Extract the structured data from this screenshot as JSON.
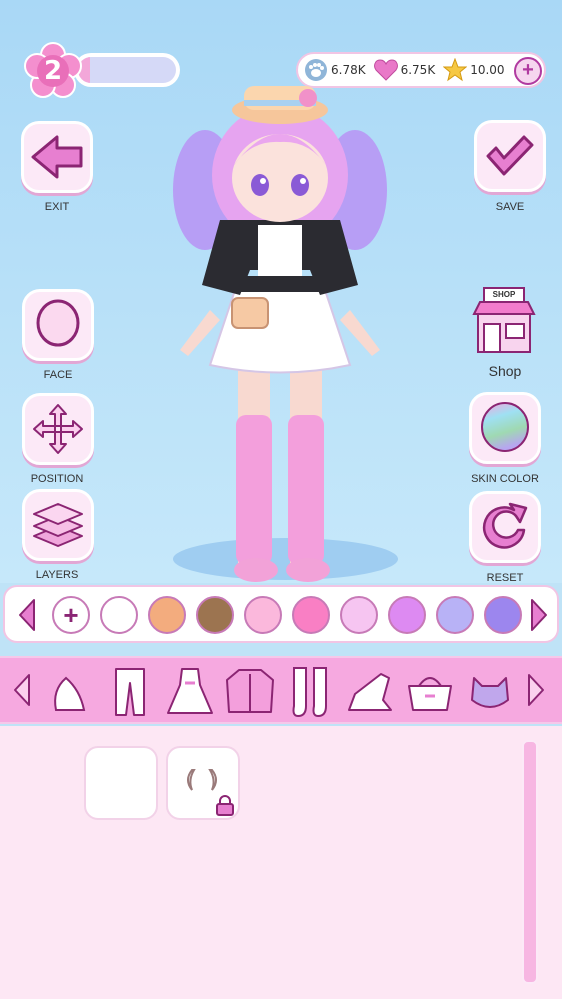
{
  "level": {
    "value": "2",
    "progress": 0.12
  },
  "currency": {
    "paw": {
      "icon": "paw-icon",
      "value": "6.78K"
    },
    "heart": {
      "icon": "heart-icon",
      "value": "6.75K"
    },
    "star": {
      "icon": "star-icon",
      "value": "10.00"
    },
    "add_label": "+"
  },
  "left_buttons": [
    {
      "label": "EXIT",
      "icon": "back-arrow-icon"
    },
    {
      "label": "FACE",
      "icon": "face-icon"
    },
    {
      "label": "POSITION",
      "icon": "move-icon"
    },
    {
      "label": "LAYERS",
      "icon": "layers-icon"
    }
  ],
  "right_buttons": [
    {
      "label": "SAVE",
      "icon": "checkmark-icon"
    },
    {
      "label": "Shop",
      "icon": "shop-icon",
      "sign": "SHOP"
    },
    {
      "label": "SKIN COLOR",
      "icon": "skin-color-icon"
    },
    {
      "label": "RESET",
      "icon": "reset-icon"
    }
  ],
  "colors": {
    "add_symbol": "+",
    "swatches": [
      "#ffffff",
      "#f3ac7e",
      "#9c7450",
      "#fbb8dc",
      "#f97fc4",
      "#f6c5f1",
      "#dd8af2",
      "#b8b2f6",
      "#9c86ee"
    ]
  },
  "categories": [
    "tail-icon",
    "pants-icon",
    "dress-icon",
    "jacket-icon",
    "socks-icon",
    "shoes-icon",
    "bag-icon",
    "pet-icon"
  ],
  "items": [
    {
      "name": "empty-slot",
      "locked": false
    },
    {
      "name": "horns-item",
      "locked": true
    }
  ],
  "palette": {
    "accent": "#b03aa0",
    "pink_bar": "#f6a9e0",
    "panel_bg": "#fde7f4",
    "sky": "#a9d8f6"
  }
}
